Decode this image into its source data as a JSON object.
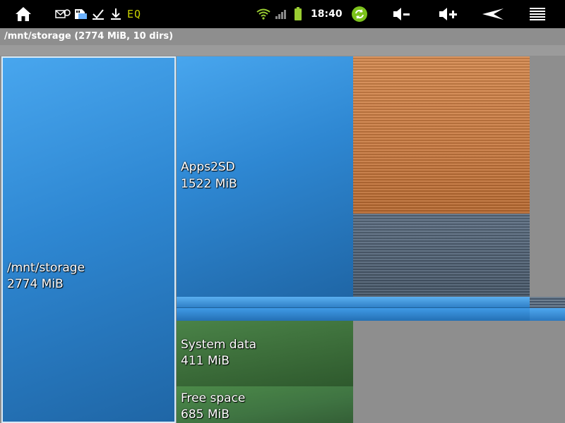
{
  "status_bar": {
    "icons": [
      "home-icon",
      "mail-icon",
      "sd-card-icon",
      "download-done-icon",
      "download-icon"
    ],
    "eq_label": "EQ",
    "system_icons": [
      "wifi-icon",
      "signal-icon",
      "battery-icon"
    ],
    "clock": "18:40",
    "nav_icons": [
      "sync-icon",
      "volume-down-icon",
      "volume-up-icon",
      "back-icon",
      "menu-icon"
    ]
  },
  "header": {
    "path": "/mnt/storage (2774 MiB, 10 dirs)"
  },
  "treemap": {
    "root": {
      "name": "/mnt/storage",
      "size": "2774 MiB"
    },
    "apps": {
      "name": "Apps2SD",
      "size": "1522 MiB"
    },
    "system": {
      "name": "System data",
      "size": "411 MiB"
    },
    "free": {
      "name": "Free space",
      "size": "685 MiB"
    }
  },
  "colors": {
    "folder_blue": "#2e87d2",
    "system_green": "#3b6c39",
    "orange_tile": "#c8783e",
    "slate_tile": "#4a5b6d",
    "background": "#8e8e8e"
  }
}
